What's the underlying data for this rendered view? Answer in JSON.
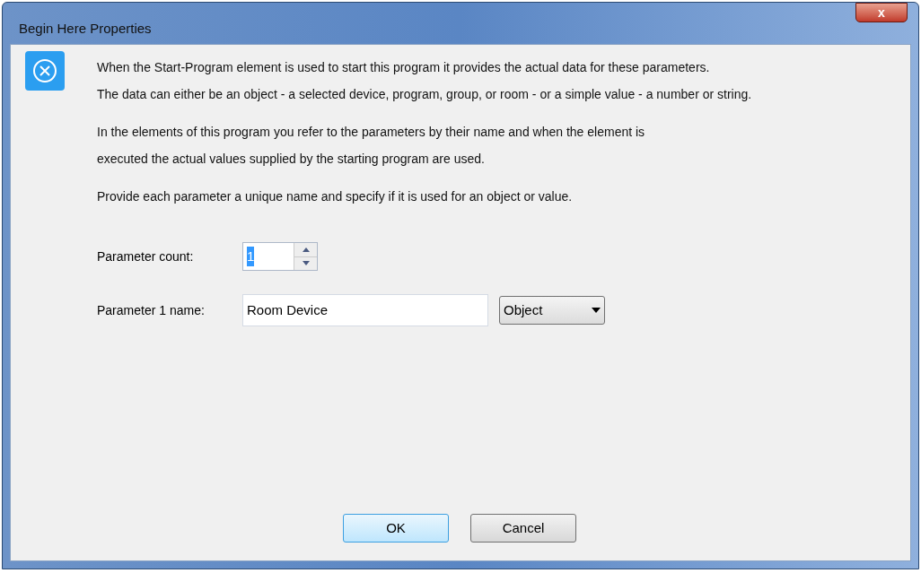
{
  "window": {
    "title": "Begin Here Properties",
    "close_button": "x"
  },
  "paragraphs": [
    {
      "lines": [
        "When the Start-Program element is used to start this program it provides the actual data for these parameters.",
        "The data can either be an object - a selected device, program, group, or room - or a simple value - a number or string."
      ]
    },
    {
      "lines": [
        "In the elements of this program you refer to the parameters by their name and when the element is",
        "executed the actual values supplied by the starting program are used."
      ]
    },
    {
      "lines": [
        "Provide each parameter a unique name and specify if it is used for an object or value."
      ]
    }
  ],
  "parameter_count": {
    "label": "Parameter count:",
    "value": "1",
    "selected": true
  },
  "parameters": [
    {
      "label": "Parameter 1 name:",
      "value": "Room Device",
      "type": "Object"
    }
  ],
  "buttons": [
    {
      "label": "OK",
      "default": true
    },
    {
      "label": "Cancel",
      "default": false
    }
  ]
}
